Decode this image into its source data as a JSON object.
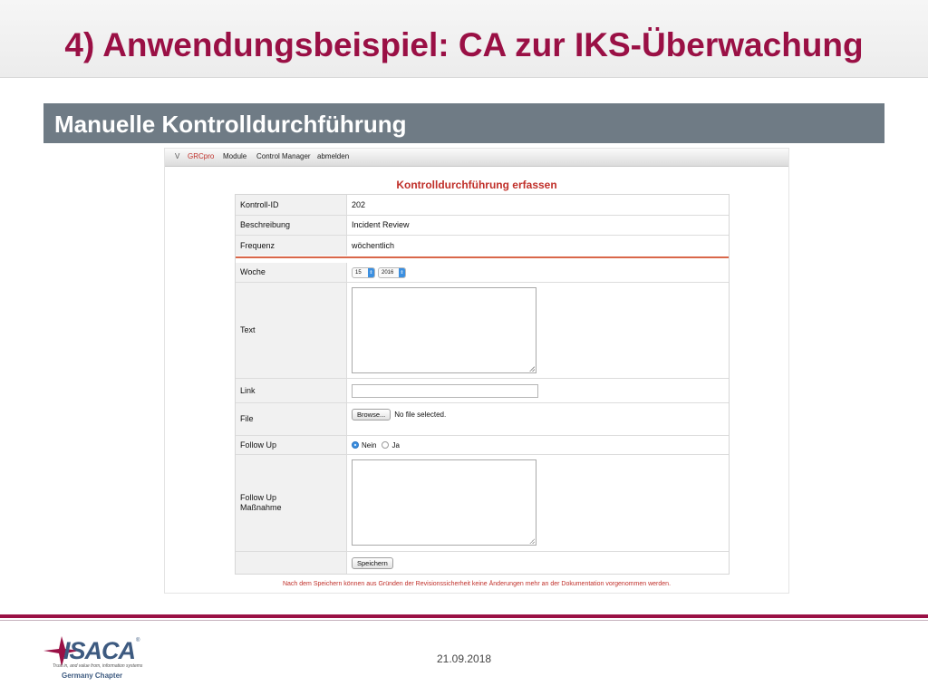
{
  "slide": {
    "title": "4) Anwendungsbeispiel: CA zur IKS-Überwachung",
    "section_title": "Manuelle Kontrolldurchführung",
    "date": "21.09.2018",
    "accent_color": "#9a1045",
    "section_color": "#6f7b85"
  },
  "app": {
    "nav": {
      "version_marker": "V",
      "brand": "GRCpro",
      "items": [
        "Module",
        "Control Manager",
        "abmelden"
      ]
    },
    "heading": "Kontrolldurchführung erfassen",
    "info_rows": [
      {
        "label": "Kontroll-ID",
        "value": "202"
      },
      {
        "label": "Beschreibung",
        "value": "Incident Review"
      },
      {
        "label": "Frequenz",
        "value": "wöchentlich"
      }
    ],
    "fields": {
      "woche_label": "Woche",
      "week_value": "15",
      "year_value": "2016",
      "text_label": "Text",
      "link_label": "Link",
      "file_label": "File",
      "browse_button": "Browse...",
      "no_file_text": "No file selected.",
      "followup_label": "Follow Up",
      "radio_nein": "Nein",
      "radio_ja": "Ja",
      "followup_measure_label_1": "Follow Up",
      "followup_measure_label_2": "Maßnahme",
      "save_button": "Speichern"
    },
    "footnote": "Nach dem Speichern können aus Gründen der Revisionssicherheit keine Änderungen mehr an der Dokumentation vorgenommen werden.",
    "status_color": "#c0302a"
  },
  "logo": {
    "name": "ISACA",
    "tagline": "Trust in, and value from, information systems",
    "chapter": "Germany Chapter"
  }
}
